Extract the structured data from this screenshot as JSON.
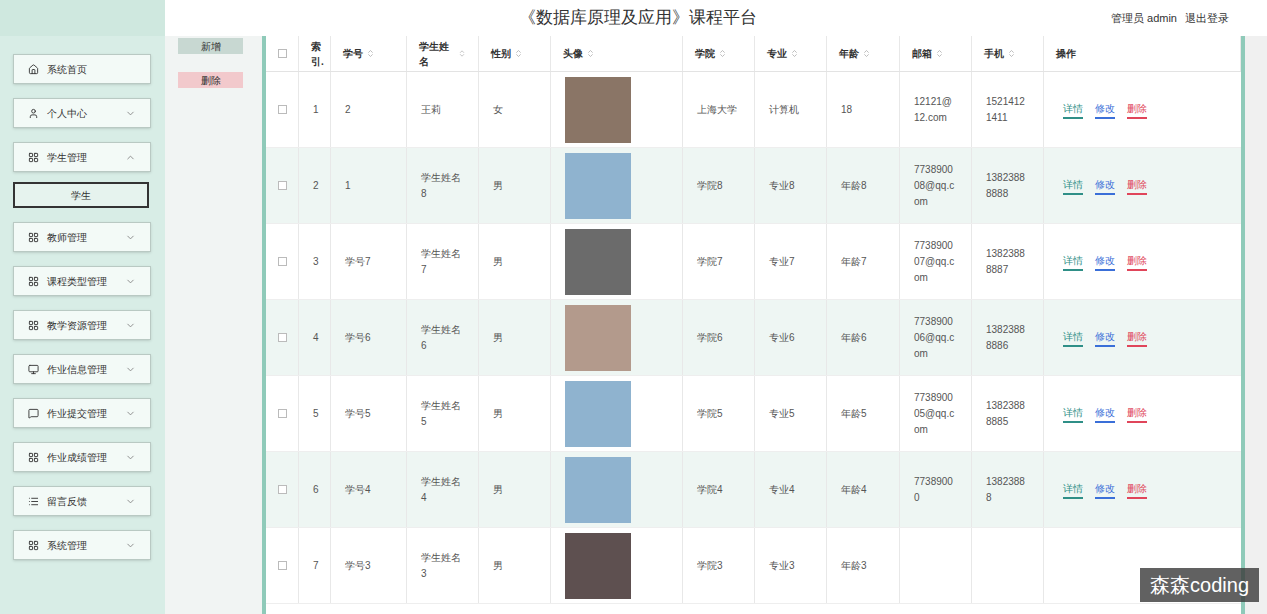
{
  "header": {
    "title": "《数据库原理及应用》课程平台",
    "user": "管理员 admin",
    "logout": "退出登录"
  },
  "sidebar": {
    "items": [
      {
        "label": "系统首页",
        "expandable": false,
        "expanded": false,
        "children": []
      },
      {
        "label": "个人中心",
        "expandable": true,
        "expanded": false,
        "children": []
      },
      {
        "label": "学生管理",
        "expandable": true,
        "expanded": true,
        "children": [
          {
            "label": "学生",
            "selected": true
          }
        ]
      },
      {
        "label": "教师管理",
        "expandable": true,
        "expanded": false,
        "children": []
      },
      {
        "label": "课程类型管理",
        "expandable": true,
        "expanded": false,
        "children": []
      },
      {
        "label": "教学资源管理",
        "expandable": true,
        "expanded": false,
        "children": []
      },
      {
        "label": "作业信息管理",
        "expandable": true,
        "expanded": false,
        "children": []
      },
      {
        "label": "作业提交管理",
        "expandable": true,
        "expanded": false,
        "children": []
      },
      {
        "label": "作业成绩管理",
        "expandable": true,
        "expanded": false,
        "children": []
      },
      {
        "label": "留言反馈",
        "expandable": true,
        "expanded": false,
        "children": []
      },
      {
        "label": "系统管理",
        "expandable": true,
        "expanded": false,
        "children": []
      }
    ]
  },
  "toolbar": {
    "buttons": [
      {
        "label": "新增",
        "kind": "add"
      },
      {
        "label": "删除",
        "kind": "delete"
      }
    ]
  },
  "table": {
    "columns": [
      {
        "label": "索引.",
        "sortable": false
      },
      {
        "label": "学号",
        "sortable": true
      },
      {
        "label": "学生姓名",
        "sortable": true
      },
      {
        "label": "性别",
        "sortable": true
      },
      {
        "label": "头像",
        "sortable": true
      },
      {
        "label": "学院",
        "sortable": true
      },
      {
        "label": "专业",
        "sortable": true
      },
      {
        "label": "年龄",
        "sortable": true
      },
      {
        "label": "邮箱",
        "sortable": true
      },
      {
        "label": "手机",
        "sortable": true
      },
      {
        "label": "操作",
        "sortable": false
      }
    ],
    "rows": [
      {
        "checked": false,
        "cells": [
          "1",
          "2",
          "王莉",
          "女",
          "上海大学",
          "计算机",
          "18",
          "12121@12.com",
          "15214121411"
        ],
        "actions": [
          "详情",
          "修改",
          "删除"
        ]
      },
      {
        "checked": false,
        "cells": [
          "2",
          "1",
          "学生姓名8",
          "男",
          "学院8",
          "专业8",
          "年龄8",
          "773890008@qq.com",
          "13823888888"
        ],
        "actions": [
          "详情",
          "修改",
          "删除"
        ]
      },
      {
        "checked": false,
        "cells": [
          "3",
          "学号7",
          "学生姓名7",
          "男",
          "学院7",
          "专业7",
          "年龄7",
          "773890007@qq.com",
          "13823888887"
        ],
        "actions": [
          "详情",
          "修改",
          "删除"
        ]
      },
      {
        "checked": false,
        "cells": [
          "4",
          "学号6",
          "学生姓名6",
          "男",
          "学院6",
          "专业6",
          "年龄6",
          "773890006@qq.com",
          "13823888886"
        ],
        "actions": [
          "详情",
          "修改",
          "删除"
        ]
      },
      {
        "checked": false,
        "cells": [
          "5",
          "学号5",
          "学生姓名5",
          "男",
          "学院5",
          "专业5",
          "年龄5",
          "773890005@qq.com",
          "13823888885"
        ],
        "actions": [
          "详情",
          "修改",
          "删除"
        ]
      },
      {
        "checked": false,
        "cells": [
          "6",
          "学号4",
          "学生姓名4",
          "男",
          "学院4",
          "专业4",
          "年龄4",
          "77389000",
          "13823888"
        ],
        "actions": [
          "详情",
          "修改",
          "删除"
        ]
      },
      {
        "checked": false,
        "cells": [
          "7",
          "学号3",
          "学生姓名3",
          "男",
          "学院3",
          "专业3",
          "年龄3",
          "",
          ""
        ],
        "actions": []
      }
    ]
  },
  "watermark": "森森coding"
}
